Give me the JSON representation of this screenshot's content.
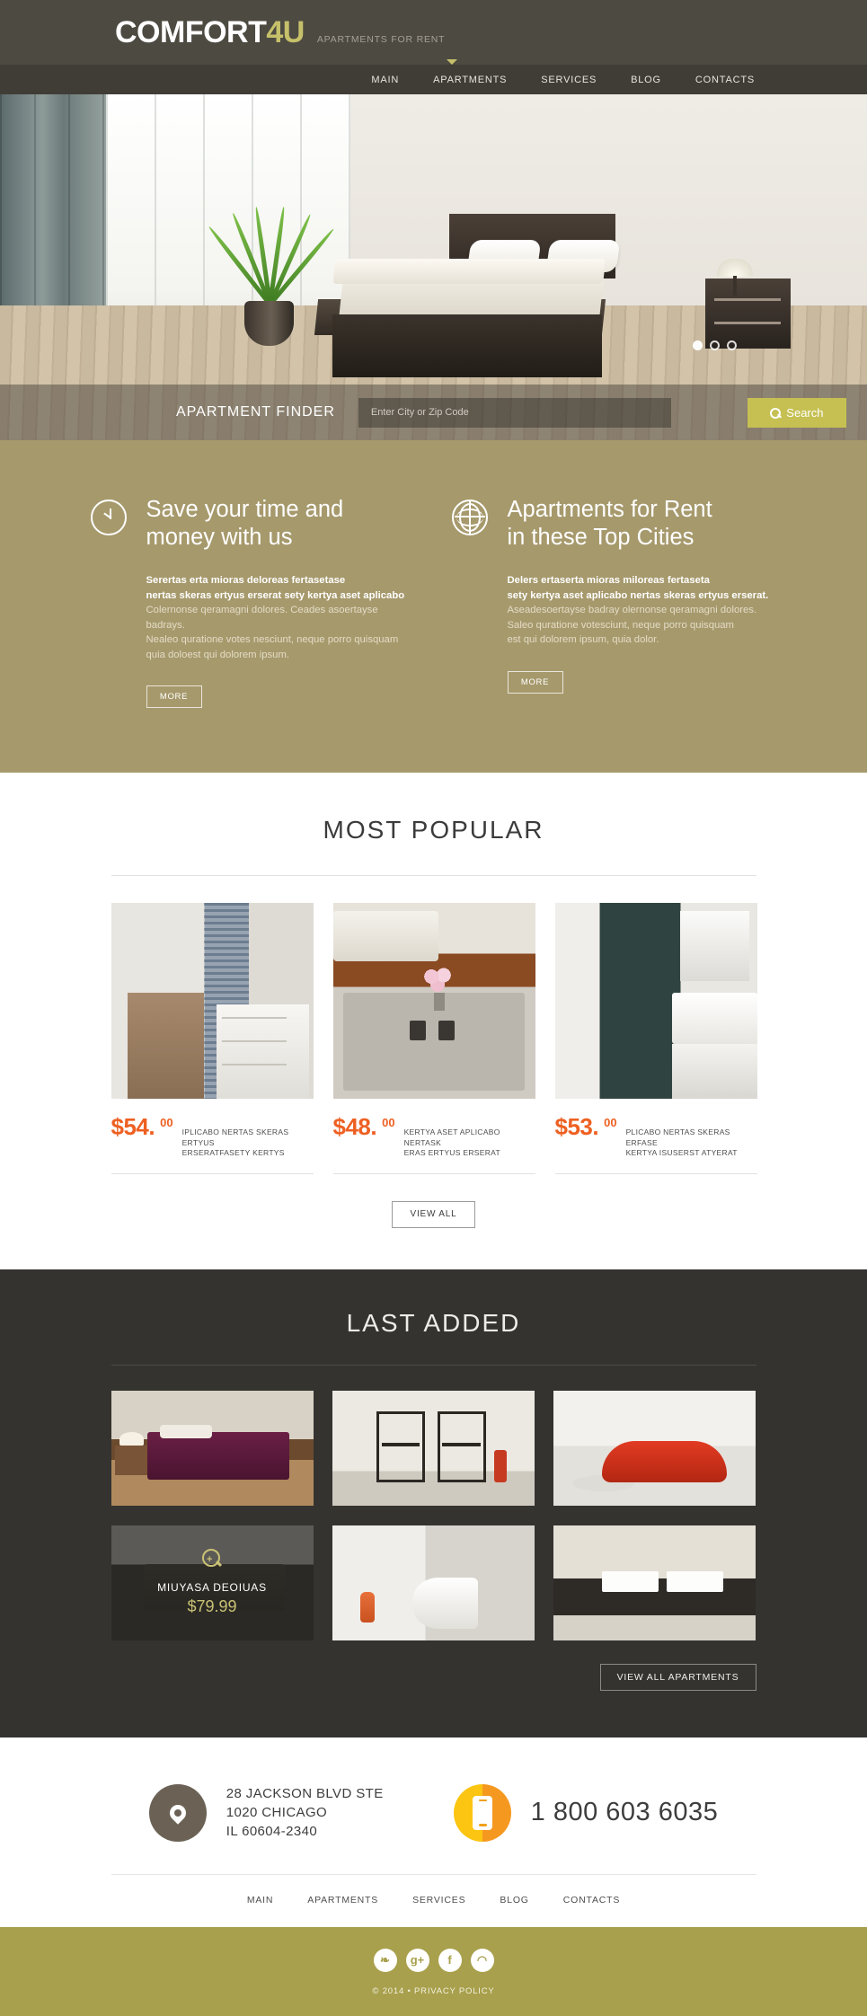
{
  "header": {
    "logo_main": "COMFORT",
    "logo_accent": "4U",
    "tagline": "APARTMENTS FOR RENT"
  },
  "nav": {
    "items": [
      {
        "label": "MAIN",
        "active": true
      },
      {
        "label": "APARTMENTS",
        "active": false
      },
      {
        "label": "SERVICES",
        "active": false
      },
      {
        "label": "BLOG",
        "active": false
      },
      {
        "label": "CONTACTS",
        "active": false
      }
    ]
  },
  "hero": {
    "slider_dots": 3,
    "active_dot": 0
  },
  "finder": {
    "label": "APARTMENT FINDER",
    "input_value": "",
    "input_placeholder": "Enter City or Zip Code",
    "search_button": "Search",
    "search_icon": "search-icon"
  },
  "features": [
    {
      "icon": "clock-icon",
      "title": "Save your time and\nmoney with us",
      "lead": "Serertas erta mioras deloreas fertasetase\nnertas skeras ertyus erserat sety kertya aset aplicabo",
      "body": "Colernonse qeramagni dolores. Ceades asoertayse badrays.\nNealeo quratione votes nesciunt, neque porro quisquam\nquia doloest qui dolorem ipsum.",
      "button": "MORE"
    },
    {
      "icon": "globe-icon",
      "title": "Apartments for Rent\nin these Top Cities",
      "lead": "Delers ertaserta mioras miloreas fertaseta\nsety kertya aset aplicabo nertas skeras ertyus erserat.",
      "body": "Aseadesoertayse badray olernonse qeramagni dolores.\nSaleo quratione votesciunt, neque porro quisquam\nest qui dolorem ipsum, quia dolor.",
      "button": "MORE"
    }
  ],
  "popular": {
    "title": "MOST POPULAR",
    "cards": [
      {
        "price": "$54.",
        "cents": "00",
        "desc": "IPLICABO NERTAS SKERAS ERTYUS\nERSERATFASETY KERTYS"
      },
      {
        "price": "$48.",
        "cents": "00",
        "desc": "KERTYA ASET APLICABO NERTASK\nERAS ERTYUS ERSERAT"
      },
      {
        "price": "$53.",
        "cents": "00",
        "desc": "PLICABO NERTAS SKERAS ERFASE\nKERTYA ISUSERST ATYERAT"
      }
    ],
    "view_all_button": "VIEW ALL"
  },
  "last_added": {
    "title": "LAST ADDED",
    "tiles": [
      {
        "overlay": false,
        "name": "",
        "price": ""
      },
      {
        "overlay": false,
        "name": "",
        "price": ""
      },
      {
        "overlay": false,
        "name": "",
        "price": ""
      },
      {
        "overlay": true,
        "name": "MIUYASA DEOIUAS",
        "price": "$79.99",
        "zoom_icon": "zoom-in-icon"
      },
      {
        "overlay": false,
        "name": "",
        "price": ""
      },
      {
        "overlay": false,
        "name": "",
        "price": ""
      }
    ],
    "view_all_button": "VIEW ALL APARTMENTS"
  },
  "contact": {
    "address_icon": "map-pin-icon",
    "address": "28 JACKSON BLVD STE\n1020 CHICAGO\nIL 60604-2340",
    "phone_icon": "mobile-phone-icon",
    "phone": "1 800 603 6035"
  },
  "footer": {
    "nav": [
      "MAIN",
      "APARTMENTS",
      "SERVICES",
      "BLOG",
      "CONTACTS"
    ],
    "social": [
      {
        "name": "twitter-icon",
        "glyph": "❧"
      },
      {
        "name": "google-plus-icon",
        "glyph": "g+"
      },
      {
        "name": "facebook-icon",
        "glyph": "f"
      },
      {
        "name": "rss-icon",
        "glyph": "◠"
      }
    ],
    "copyright": "© 2014 • PRIVACY POLICY"
  },
  "colors": {
    "header_bg": "#4d4a42",
    "nav_bg": "#403d36",
    "accent_gold": "#c6c06a",
    "features_bg": "#a6996c",
    "dark_bg": "#343330",
    "price_orange": "#ee6022",
    "bottom_bar": "#a8a04c",
    "search_btn": "#c6c053"
  }
}
